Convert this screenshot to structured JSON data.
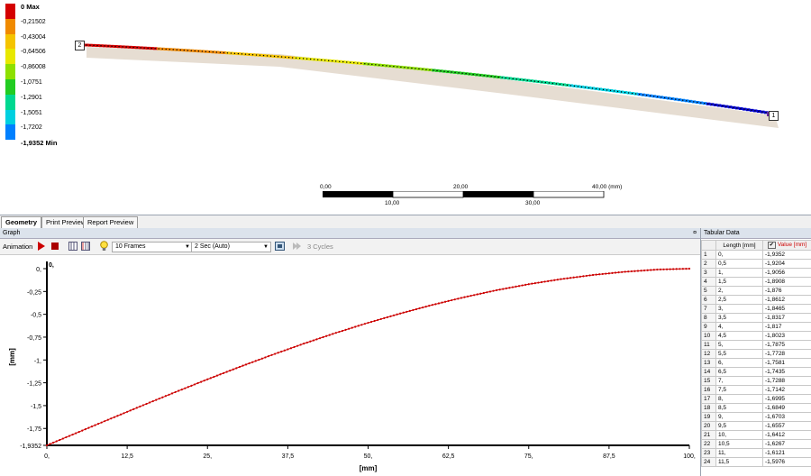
{
  "legend": {
    "items": [
      {
        "label": "0 Max",
        "color": "#d40000",
        "bold": true
      },
      {
        "label": "-0,21502",
        "color": "#f08a00"
      },
      {
        "label": "-0,43004",
        "color": "#f5c400"
      },
      {
        "label": "-0,64506",
        "color": "#e8e800"
      },
      {
        "label": "-0,86008",
        "color": "#8ee000"
      },
      {
        "label": "-1,0751",
        "color": "#22cc22"
      },
      {
        "label": "-1,2901",
        "color": "#00d890"
      },
      {
        "label": "-1,5051",
        "color": "#00d0e0"
      },
      {
        "label": "-1,7202",
        "color": "#0080ff"
      },
      {
        "label": "-1,9352 Min",
        "color": "#0000d0",
        "bold": true
      }
    ]
  },
  "viewport": {
    "node_left": "2",
    "node_right": "1"
  },
  "scale_bar": {
    "top_labels": [
      "0,00",
      "20,00",
      "40,00 (mm)"
    ],
    "bottom_labels": [
      "10,00",
      "30,00"
    ]
  },
  "tabs": [
    "Geometry",
    "Print Preview",
    "Report Preview"
  ],
  "graph_panel": {
    "title": "Graph",
    "pin": "¤",
    "toolbar": {
      "animation_label": "Animation",
      "frames": "10 Frames",
      "duration": "2 Sec (Auto)",
      "cycles": "3 Cycles"
    }
  },
  "chart_data": {
    "type": "line",
    "xlabel": "[mm]",
    "ylabel": "[mm]",
    "xlim": [
      0,
      100
    ],
    "ylim": [
      -1.9352,
      0
    ],
    "x_ticks": [
      "0,",
      "12,5",
      "25,",
      "37,5",
      "50,",
      "62,5",
      "75,",
      "87,5",
      "100,"
    ],
    "y_ticks": [
      "0,",
      "-0,25",
      "-0,5",
      "-0,75",
      "-1,",
      "-1,25",
      "-1,5",
      "-1,75",
      "-1,9352"
    ],
    "y_tick_values": [
      0,
      -0.25,
      -0.5,
      -0.75,
      -1,
      -1.25,
      -1.5,
      -1.75,
      -1.9352
    ],
    "x_axis_top_label": "0,",
    "series": [
      {
        "color": "#cc0000",
        "x": [
          0,
          5,
          10,
          15,
          20,
          25,
          30,
          35,
          40,
          45,
          50,
          55,
          60,
          65,
          70,
          75,
          80,
          85,
          90,
          95,
          100
        ],
        "y": [
          -1.9352,
          -1.788,
          -1.641,
          -1.495,
          -1.352,
          -1.212,
          -1.076,
          -0.946,
          -0.821,
          -0.703,
          -0.593,
          -0.491,
          -0.397,
          -0.312,
          -0.236,
          -0.17,
          -0.115,
          -0.069,
          -0.034,
          -0.01,
          0
        ]
      }
    ]
  },
  "tabular": {
    "title": "Tabular Data",
    "col_length": "Length [mm]",
    "col_value": "Value [mm]",
    "checkbox": "✔",
    "rows": [
      [
        "1",
        "0,",
        "-1,9352"
      ],
      [
        "2",
        "0,5",
        "-1,9204"
      ],
      [
        "3",
        "1,",
        "-1,9056"
      ],
      [
        "4",
        "1,5",
        "-1,8908"
      ],
      [
        "5",
        "2,",
        "-1,876"
      ],
      [
        "6",
        "2,5",
        "-1,8612"
      ],
      [
        "7",
        "3,",
        "-1,8465"
      ],
      [
        "8",
        "3,5",
        "-1,8317"
      ],
      [
        "9",
        "4,",
        "-1,817"
      ],
      [
        "10",
        "4,5",
        "-1,8023"
      ],
      [
        "11",
        "5,",
        "-1,7875"
      ],
      [
        "12",
        "5,5",
        "-1,7728"
      ],
      [
        "13",
        "6,",
        "-1,7581"
      ],
      [
        "14",
        "6,5",
        "-1,7435"
      ],
      [
        "15",
        "7,",
        "-1,7288"
      ],
      [
        "16",
        "7,5",
        "-1,7142"
      ],
      [
        "17",
        "8,",
        "-1,6995"
      ],
      [
        "18",
        "8,5",
        "-1,6849"
      ],
      [
        "19",
        "9,",
        "-1,6703"
      ],
      [
        "20",
        "9,5",
        "-1,6557"
      ],
      [
        "21",
        "10,",
        "-1,6412"
      ],
      [
        "22",
        "10,5",
        "-1,6267"
      ],
      [
        "23",
        "11,",
        "-1,6121"
      ],
      [
        "24",
        "11,5",
        "-1,5976"
      ]
    ]
  }
}
